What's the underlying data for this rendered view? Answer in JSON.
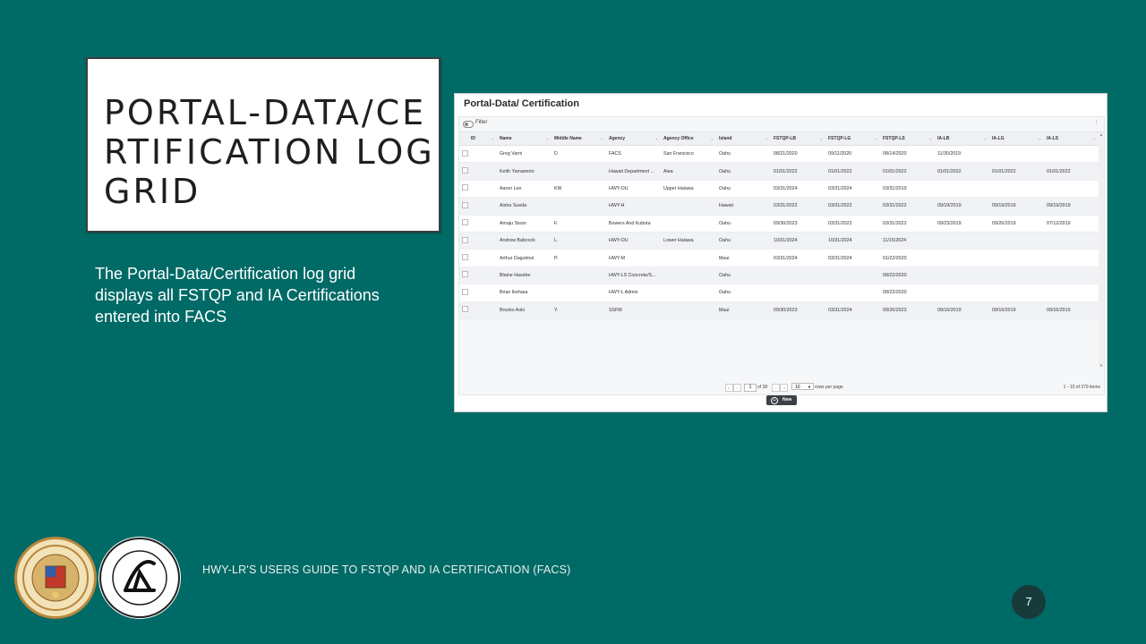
{
  "slide": {
    "title": "PORTAL-DATA/CERTIFICATION LOG GRID",
    "description": "The Portal-Data/Certification log grid displays all FSTQP and IA Certifications entered into FACS",
    "footer": "HWY-LR'S USERS GUIDE TO FSTQP AND IA CERTIFICATION (FACS)",
    "page_number": "7"
  },
  "app": {
    "title": "Portal-Data/ Certification",
    "filter_label": "Filter",
    "columns": [
      "ID",
      "Name",
      "Middle Name",
      "Agency",
      "Agency Office",
      "Island",
      "FSTQP-LB",
      "FSTQP-LG",
      "FSTQP-LS",
      "IA-LB",
      "IA-LG",
      "IA-LS"
    ],
    "rows": [
      [
        "",
        "Greg Varni",
        "D",
        "FACS",
        "San Francisco",
        "Oahu",
        "08/21/2020",
        "09/11/2020",
        "08/14/2020",
        "11/30/2019",
        "",
        ""
      ],
      [
        "",
        "Keith Yamamoto",
        "",
        "Hawaii Department ...",
        "Aiea",
        "Oahu",
        "01/01/2022",
        "01/01/2022",
        "01/01/2022",
        "01/01/2022",
        "01/01/2022",
        "01/01/2022"
      ],
      [
        "",
        "Aaron Lee",
        "KW",
        "HWY-OU",
        "Upper Halawa",
        "Oahu",
        "03/31/2024",
        "03/31/2024",
        "03/31/2019",
        "",
        "",
        ""
      ],
      [
        "",
        "Aisha Sueda",
        "",
        "HWY-H",
        "",
        "Hawaii",
        "03/31/2022",
        "03/31/2022",
        "03/31/2022",
        "09/19/2019",
        "09/19/2019",
        "09/19/2019"
      ],
      [
        "",
        "Amaju Sison",
        "F.",
        "Bowers And Kubota",
        "",
        "Oahu",
        "09/30/2023",
        "03/31/2022",
        "03/31/2022",
        "09/23/2019",
        "09/26/2019",
        "07/12/2019"
      ],
      [
        "",
        "Andrew Babcock",
        "L.",
        "HWY-OU",
        "Lower Halawa",
        "Oahu",
        "10/31/2024",
        "10/31/2024",
        "11/15/2024",
        "",
        "",
        ""
      ],
      [
        "",
        "Arthur Dagulmoi",
        "P.",
        "HWY-M",
        "",
        "Maui",
        "03/31/2024",
        "03/31/2024",
        "01/22/2020",
        "",
        "",
        ""
      ],
      [
        "",
        "Blaine Hasebe",
        "",
        "HWY-LS Concrete/S...",
        "",
        "Oahu",
        "",
        "",
        "08/22/2020",
        "",
        "",
        ""
      ],
      [
        "",
        "Brian Ikehara",
        "",
        "HWY-L Admin",
        "",
        "Oahu",
        "",
        "",
        "08/22/2020",
        "",
        "",
        ""
      ],
      [
        "",
        "Brooks Aoki",
        "Y.",
        "SSFM",
        "",
        "Maui",
        "09/30/2023",
        "03/31/2024",
        "09/26/2023",
        "09/16/2019",
        "09/16/2019",
        "09/16/2019"
      ]
    ],
    "pager": {
      "current_page": "1",
      "of_pages": "of 38",
      "page_size": "10",
      "rows_per_page_label": "rows per page",
      "items_summary": "1 - 10 of 379 items"
    },
    "new_button": "New"
  },
  "icons": {
    "toggle": "toggle-icon",
    "kebab": "kebab-menu-icon",
    "new": "plus-circle-icon"
  },
  "colors": {
    "background": "#006a66",
    "page_badge": "#173a3a",
    "new_button": "#3b3f46"
  }
}
